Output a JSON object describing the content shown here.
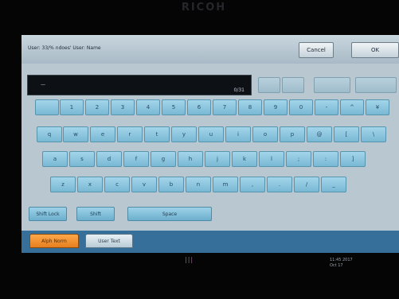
{
  "brand": "RICOH",
  "header": {
    "title": "User: 33/% ndoes' User: Name",
    "cancel_label": "Cancel",
    "ok_label": "OK"
  },
  "input": {
    "cursor": "—",
    "counter": "0/31"
  },
  "keyboard": {
    "row1": [
      "",
      "1",
      "2",
      "3",
      "4",
      "5",
      "6",
      "7",
      "8",
      "9",
      "0",
      "-",
      "^",
      "¥"
    ],
    "row2": [
      "q",
      "w",
      "e",
      "r",
      "t",
      "y",
      "u",
      "i",
      "o",
      "p",
      "@",
      "[",
      "\\"
    ],
    "row3": [
      "a",
      "s",
      "d",
      "f",
      "g",
      "h",
      "j",
      "k",
      "l",
      ";",
      ":",
      "]"
    ],
    "row4": [
      "z",
      "x",
      "c",
      "v",
      "b",
      "n",
      "m",
      ",",
      ".",
      "/",
      "_"
    ]
  },
  "functions": {
    "shift_lock": "Shift Lock",
    "shift": "Shift",
    "space": "Space"
  },
  "tabs": {
    "active": "Alph Norm",
    "other": "User Text"
  },
  "status": {
    "line1": "11:45  2017",
    "line2": "Oct 17"
  },
  "led": "|||"
}
